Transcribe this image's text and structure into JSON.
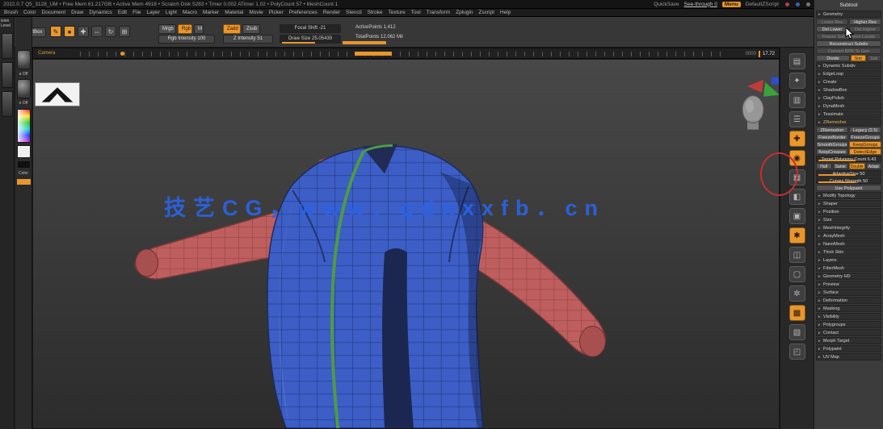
{
  "titlebar": {
    "info": "2022.0.7 Q5_3128_UM  •  Free Mem 61.217GB  •  Active Mem 4918  •  Scratch Disk 5283  •  Timer 0.002 ATimer 1.02  •  PolyCount 57  •  MeshCount 1",
    "quicksave": "QuickSave",
    "see_through": "See-through 0",
    "menu_badge": "Menu",
    "zscript": "DefaultZScript"
  },
  "menubar": {
    "items": [
      "Brush",
      "Color",
      "Document",
      "Draw",
      "Dynamics",
      "Edit",
      "File",
      "Layer",
      "Light",
      "Macro",
      "Marker",
      "Material",
      "Movie",
      "Picker",
      "Preferences",
      "Render",
      "Stencil",
      "Stroke",
      "Texture",
      "Tool",
      "Transform",
      "Zplugin",
      "Zscript",
      "Help"
    ]
  },
  "toolbar": {
    "lightbox": "LightBox",
    "tools": [
      {
        "name": "edit-icon",
        "g": "✎",
        "s": "on"
      },
      {
        "name": "draw-icon",
        "g": "●",
        "s": "on"
      },
      {
        "name": "move-icon",
        "g": "✚"
      },
      {
        "name": "scale-icon",
        "g": "⇔"
      },
      {
        "name": "rotate-icon",
        "g": "↻"
      },
      {
        "name": "sculpt-icon",
        "g": "⊞"
      }
    ],
    "mrgb": "Mrgb",
    "rgb": "Rgb",
    "m": "M",
    "rgb_intensity": "Rgb Intensity 100",
    "zadd": "Zadd",
    "zsub": "Zsub",
    "z_intensity": "Z Intensity 51",
    "focal_shift": "Focal Shift -21",
    "draw_size": "Draw Size 25.05439",
    "active_points": "ActivePoints 1,412",
    "total_points": "TotalPoints 12.062 Mil"
  },
  "timeline": {
    "label": "Camera",
    "frame": "0000",
    "time": "17.72"
  },
  "left_tray": {
    "top_label": "ision Level",
    "alpha_label": "a Off",
    "texture_label": "e Off",
    "color_label": "Color"
  },
  "canvas": {
    "watermark": "技艺CG，www．qdnxxfb．cn"
  },
  "right_tray": {
    "icons": [
      {
        "g": "▤"
      },
      {
        "g": "✦"
      },
      {
        "g": "▥"
      },
      {
        "g": "☰"
      },
      {
        "g": "✚",
        "s": "on"
      },
      {
        "g": "◉",
        "s": "on"
      },
      {
        "g": "▦"
      },
      {
        "g": "◧"
      },
      {
        "g": "▣"
      },
      {
        "g": "✱",
        "s": "on"
      },
      {
        "g": "◫"
      },
      {
        "g": "▢"
      },
      {
        "g": "✲"
      },
      {
        "g": "▩",
        "s": "on"
      },
      {
        "g": "▧"
      },
      {
        "g": "◰"
      }
    ]
  },
  "right_panel": {
    "title": "Subtool",
    "rows": [
      {
        "t": "sec",
        "a": "Geometry"
      },
      {
        "t": "pair",
        "a": "Lower Res",
        "b": "Higher Res",
        "a_s": "dim"
      },
      {
        "t": "pair",
        "a": "Del Lower",
        "b": "Del Higher",
        "b_s": "dim"
      },
      {
        "t": "btn",
        "a": "Freeze SubDivision Levels",
        "a_s": "dim"
      },
      {
        "t": "btn",
        "a": "Reconstruct Subdiv"
      },
      {
        "t": "btn",
        "a": "Convert BPR To Geo",
        "a_s": "dim"
      },
      {
        "t": "divide",
        "a": "Divide",
        "b": "Smt",
        "c": "Sub",
        "b_s": "on",
        "c_s": "dim"
      },
      {
        "t": "sec",
        "a": "Dynamic Subdiv"
      },
      {
        "t": "sec",
        "a": "EdgeLoop"
      },
      {
        "t": "sec",
        "a": "Create"
      },
      {
        "t": "sec",
        "a": "ShadowBox"
      },
      {
        "t": "sec",
        "a": "ClayPolish"
      },
      {
        "t": "sec",
        "a": "DynaMesh"
      },
      {
        "t": "sec",
        "a": "Tessimate"
      },
      {
        "t": "sec",
        "a": "ZRemesher",
        "a_s": "hl"
      },
      {
        "t": "pair",
        "a": "ZRemesher",
        "b": "Legacy (2.5)"
      },
      {
        "t": "pair",
        "a": "FreezeBorder",
        "b": "FreezeGroups"
      },
      {
        "t": "pair",
        "a": "SmoothGroups",
        "b": "KeepGroups",
        "b_s": "on"
      },
      {
        "t": "pair",
        "a": "KeepCreases",
        "b": "DetectEdge",
        "b_s": "on"
      },
      {
        "t": "sld",
        "a": "Target Polygons Count 6.43"
      },
      {
        "t": "chips",
        "a": "Half",
        "b": "Same",
        "c": "Double",
        "d": "Adapt",
        "c_s": "on"
      },
      {
        "t": "sld",
        "a": "AdaptiveSize 50"
      },
      {
        "t": "sld",
        "a": "Curves Strength 50"
      },
      {
        "t": "btn",
        "a": "Use Polypaint"
      },
      {
        "t": "sec",
        "a": "Modify Topology"
      },
      {
        "t": "sec",
        "a": "Shaper"
      },
      {
        "t": "sec",
        "a": "Position"
      },
      {
        "t": "sec",
        "a": "Size"
      },
      {
        "t": "sec",
        "a": "MeshIntegrity"
      },
      {
        "t": "sec",
        "a": "ArrayMesh"
      },
      {
        "t": "sec",
        "a": "NanoMesh"
      },
      {
        "t": "sec",
        "a": "Thick Skin"
      },
      {
        "t": "sec",
        "a": "Layers"
      },
      {
        "t": "sec",
        "a": "FiberMesh"
      },
      {
        "t": "sec",
        "a": "Geometry HD"
      },
      {
        "t": "sec",
        "a": "Preview"
      },
      {
        "t": "sec",
        "a": "Surface"
      },
      {
        "t": "sec",
        "a": "Deformation"
      },
      {
        "t": "sec",
        "a": "Masking"
      },
      {
        "t": "sec",
        "a": "Visibility"
      },
      {
        "t": "sec",
        "a": "Polygroups"
      },
      {
        "t": "sec",
        "a": "Contact"
      },
      {
        "t": "sec",
        "a": "Morph Target"
      },
      {
        "t": "sec",
        "a": "Polypaint"
      },
      {
        "t": "sec",
        "a": "UV Map"
      }
    ]
  },
  "colors": {
    "accent": "#e8962e",
    "watermark_blue": "#2a63e6"
  }
}
